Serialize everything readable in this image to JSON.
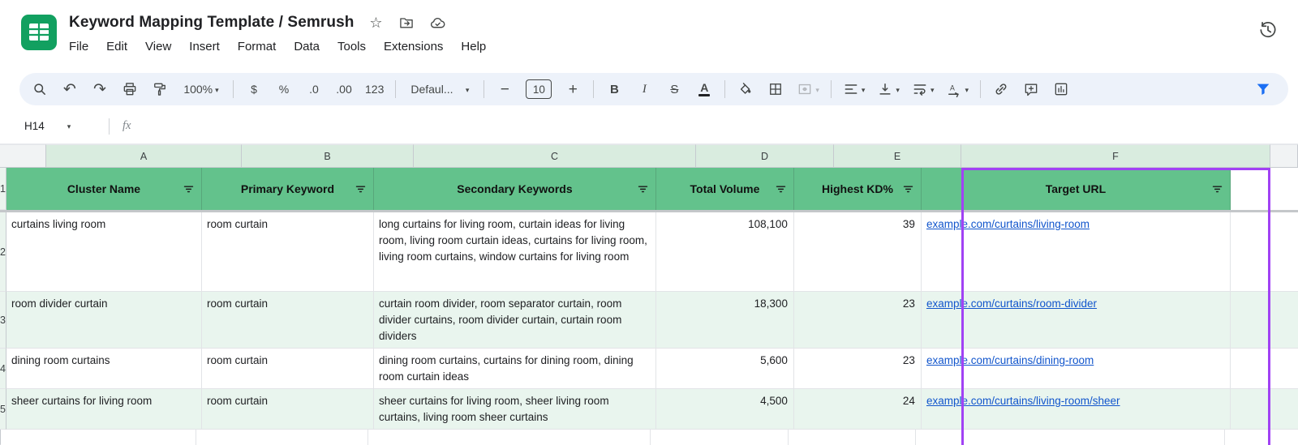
{
  "app": {
    "title": "Keyword Mapping Template / Semrush"
  },
  "menu": {
    "items": [
      "File",
      "Edit",
      "View",
      "Insert",
      "Format",
      "Data",
      "Tools",
      "Extensions",
      "Help"
    ]
  },
  "toolbar": {
    "zoom_level": "100%",
    "currency": "$",
    "percent": "%",
    "decrease_decimal": ".0",
    "increase_decimal": ".00",
    "more_formats": "123",
    "font_name": "Defaul...",
    "font_size": "10",
    "decrease_font": "−",
    "increase_font": "+",
    "bold": "B",
    "italic": "I",
    "strikethrough": "S",
    "text_color": "A"
  },
  "formula_bar": {
    "cell_ref": "H14",
    "fx_label": "fx"
  },
  "sheet": {
    "column_letters": [
      "A",
      "B",
      "C",
      "D",
      "E",
      "F"
    ],
    "headers": [
      "Cluster Name",
      "Primary Keyword",
      "Secondary Keywords",
      "Total Volume",
      "Highest KD%",
      "Target URL"
    ],
    "rows": [
      {
        "num": 2,
        "cluster": "curtains living room",
        "primary": "room curtain",
        "secondary": "long curtains for living room, curtain ideas for living room, living room curtain ideas, curtains for living room, living room curtains, window curtains for living room",
        "volume": "108,100",
        "kd": "39",
        "url": "example.com/curtains/living-room"
      },
      {
        "num": 3,
        "cluster": "room divider curtain",
        "primary": "room curtain",
        "secondary": "curtain room divider, room separator curtain, room divider curtains, room divider curtain, curtain room dividers",
        "volume": "18,300",
        "kd": "23",
        "url": "example.com/curtains/room-divider"
      },
      {
        "num": 4,
        "cluster": "dining room curtains",
        "primary": "room curtain",
        "secondary": "dining room curtains, curtains for dining room, dining room curtain ideas",
        "volume": "5,600",
        "kd": "23",
        "url": "example.com/curtains/dining-room"
      },
      {
        "num": 5,
        "cluster": "sheer curtains for living room",
        "primary": "room curtain",
        "secondary": "sheer curtains for living room, sheer living room curtains, living room sheer curtains",
        "volume": "4,500",
        "kd": "24",
        "url": "example.com/curtains/living-room/sheer"
      }
    ]
  },
  "icons": {
    "star": "☆",
    "dropdown": "▾",
    "undo": "↶",
    "redo": "↷"
  },
  "colors": {
    "header_green": "#63c28c",
    "band_green": "#e9f5ee",
    "colhead_green": "#d9ecdf",
    "gutter_green": "#eaf4ee",
    "selection_purple": "#a142f4",
    "link_blue": "#1155cc",
    "filter_blue": "#1a6ef3"
  }
}
